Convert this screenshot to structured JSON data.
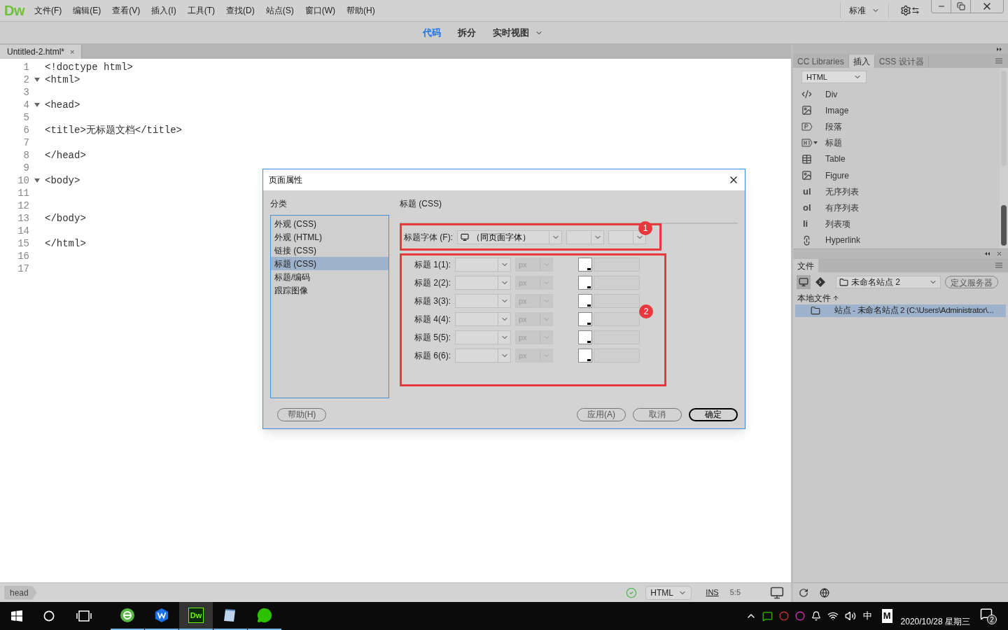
{
  "app": {
    "logo": "Dw",
    "menu": [
      "文件(F)",
      "编辑(E)",
      "查看(V)",
      "插入(I)",
      "工具(T)",
      "查找(D)",
      "站点(S)",
      "窗口(W)",
      "帮助(H)"
    ],
    "workspace": "标准"
  },
  "view_tabs": [
    {
      "label": "代码",
      "selected": true
    },
    {
      "label": "拆分",
      "selected": false
    },
    {
      "label": "实时视图",
      "selected": false
    }
  ],
  "document_tab": {
    "title": "Untitled-2.html*",
    "close": "×"
  },
  "code_lines": [
    {
      "number": "1",
      "text": "<!doctype html>",
      "foldable": false
    },
    {
      "number": "2",
      "text": "<html>",
      "foldable": true
    },
    {
      "number": "3",
      "foldable": false
    },
    {
      "number": "4",
      "text": "<head>",
      "foldable": true
    },
    {
      "number": "5",
      "foldable": false
    },
    {
      "number": "6",
      "text": "<title>无标题文档</title>",
      "foldable": false
    },
    {
      "number": "7",
      "foldable": false
    },
    {
      "number": "8",
      "text": "</head>",
      "foldable": false
    },
    {
      "number": "9",
      "foldable": false
    },
    {
      "number": "10",
      "text": "<body>",
      "foldable": true
    },
    {
      "number": "11",
      "foldable": false
    },
    {
      "number": "12",
      "foldable": false
    },
    {
      "number": "13",
      "text": "</body>",
      "foldable": false
    },
    {
      "number": "14",
      "foldable": false
    },
    {
      "number": "15",
      "text": "</html>",
      "foldable": false
    },
    {
      "number": "16",
      "foldable": false
    },
    {
      "number": "17",
      "foldable": false
    }
  ],
  "status_bar": {
    "tag": "head",
    "language": "HTML",
    "mode": "INS",
    "position": "5:5"
  },
  "dialog": {
    "title": "页面属性",
    "category_label": "分类",
    "categories": [
      {
        "label": "外观 (CSS)",
        "selected": false
      },
      {
        "label": "外观 (HTML)",
        "selected": false
      },
      {
        "label": "链接 (CSS)",
        "selected": false
      },
      {
        "label": "标题 (CSS)",
        "selected": true
      },
      {
        "label": "标题/编码",
        "selected": false
      },
      {
        "label": "跟踪图像",
        "selected": false
      }
    ],
    "section_title": "标题 (CSS)",
    "font_row": {
      "label": "标题字体 (F):",
      "value": "（同页面字体）",
      "marker": "1"
    },
    "headings_marker": "2",
    "headings": [
      {
        "label": "标题 1(1):",
        "unit": "px"
      },
      {
        "label": "标题 2(2):",
        "unit": "px"
      },
      {
        "label": "标题 3(3):",
        "unit": "px"
      },
      {
        "label": "标题 4(4):",
        "unit": "px"
      },
      {
        "label": "标题 5(5):",
        "unit": "px"
      },
      {
        "label": "标题 6(6):",
        "unit": "px"
      }
    ],
    "buttons": [
      {
        "label": "帮助(H)",
        "default": false
      },
      {
        "label": "应用(A)",
        "default": false
      },
      {
        "label": "取消",
        "default": false
      },
      {
        "label": "确定",
        "default": true
      }
    ]
  },
  "insert_panel": {
    "tabs": [
      {
        "label": "CC Libraries",
        "selected": false
      },
      {
        "label": "插入",
        "selected": true
      },
      {
        "label": "CSS 设计器",
        "selected": false
      }
    ],
    "category": "HTML",
    "items": [
      {
        "kind": "icon",
        "label": "Div",
        "submenu": false
      },
      {
        "kind": "icon",
        "label": "Image",
        "submenu": false
      },
      {
        "kind": "icon",
        "label": "段落",
        "submenu": false
      },
      {
        "kind": "icon",
        "label": "标题",
        "submenu": true
      },
      {
        "kind": "icon",
        "label": "Table",
        "submenu": false
      },
      {
        "kind": "icon",
        "label": "Figure",
        "submenu": false
      },
      {
        "kind": "glyph",
        "glyph": "ul",
        "label": "无序列表",
        "submenu": false
      },
      {
        "kind": "glyph",
        "glyph": "ol",
        "label": "有序列表",
        "submenu": false
      },
      {
        "kind": "glyph",
        "glyph": "li",
        "label": "列表项",
        "submenu": false
      },
      {
        "kind": "icon",
        "label": "Hyperlink",
        "submenu": false
      }
    ]
  },
  "files_panel": {
    "tab": "文件",
    "site": "未命名站点 2",
    "define_server": "定义服务器",
    "header": "本地文件",
    "rows": [
      {
        "label": "站点 - 未命名站点 2 (C:\\Users\\Administrator\\...",
        "selected": true
      }
    ]
  },
  "taskbar": {
    "apps": [
      {
        "kind": "browser",
        "selected": false
      },
      {
        "kind": "wps",
        "selected": false
      },
      {
        "kind": "dreamweaver",
        "label": "Dw",
        "selected": true
      },
      {
        "kind": "notepad",
        "selected": false
      },
      {
        "kind": "chat",
        "selected": false
      }
    ],
    "ime": "中",
    "ime_mode": "M",
    "date": "2020/10/28 星期三",
    "notifications": "2"
  }
}
